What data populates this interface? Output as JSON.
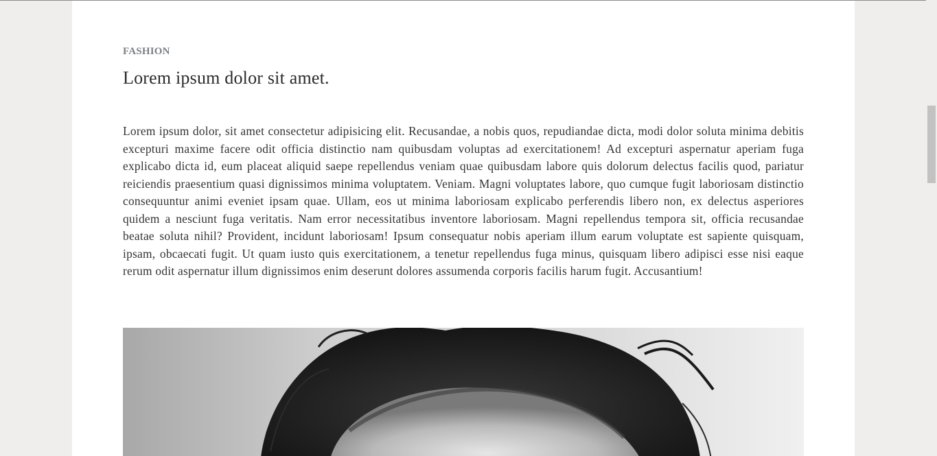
{
  "article": {
    "category": "FASHION",
    "title": "Lorem ipsum dolor sit amet.",
    "body": "Lorem ipsum dolor, sit amet consectetur adipisicing elit. Recusandae, a nobis quos, repudiandae dicta, modi dolor soluta minima debitis excepturi maxime facere odit officia distinctio nam quibusdam voluptas ad exercitationem! Ad excepturi aspernatur aperiam fuga explicabo dicta id, eum placeat aliquid saepe repellendus veniam quae quibusdam labore quis dolorum delectus facilis quod, pariatur reiciendis praesentium quasi dignissimos minima voluptatem. Veniam. Magni voluptates labore, quo cumque fugit laboriosam distinctio consequuntur animi eveniet ipsam quae. Ullam, eos ut minima laboriosam explicabo perferendis libero non, ex delectus asperiores quidem a nesciunt fuga veritatis. Nam error necessitatibus inventore laboriosam. Magni repellendus tempora sit, officia recusandae beatae soluta nihil? Provident, incidunt laboriosam! Ipsum consequatur nobis aperiam illum earum voluptate est sapiente quisquam, ipsam, obcaecati fugit. Ut quam iusto quis exercitationem, a tenetur repellendus fuga minus, quisquam libero adipisci esse nisi eaque rerum odit aspernatur illum dignissimos enim deserunt dolores assumenda corporis facilis harum fugit. Accusantium!"
  },
  "hero_image": {
    "subject": "black-and-white portrait photo"
  },
  "colors": {
    "background": "#efeeec",
    "page": "#ffffff",
    "category_text": "#7b7f86",
    "title_text": "#2a2a2a",
    "body_text": "#333333",
    "scrollbar_thumb": "#c2c2c2"
  }
}
